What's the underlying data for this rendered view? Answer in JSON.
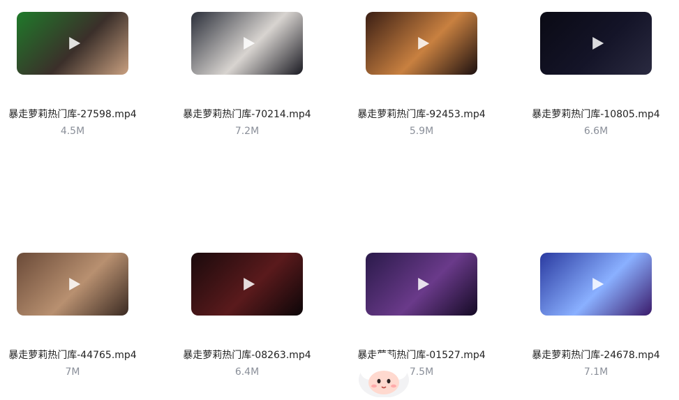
{
  "files": [
    {
      "name": "暴走萝莉热门库-27598.mp4",
      "size": "4.5M",
      "thumb_colors": [
        "#1f7a2a",
        "#3b2f2a",
        "#c9a080"
      ]
    },
    {
      "name": "暴走萝莉热门库-70214.mp4",
      "size": "7.2M",
      "thumb_colors": [
        "#2b2f3a",
        "#d8d4d0",
        "#1a1a22"
      ]
    },
    {
      "name": "暴走萝莉热门库-92453.mp4",
      "size": "5.9M",
      "thumb_colors": [
        "#3a1e14",
        "#c88040",
        "#1c1010"
      ]
    },
    {
      "name": "暴走萝莉热门库-10805.mp4",
      "size": "6.6M",
      "thumb_colors": [
        "#0a0a14",
        "#141428",
        "#2a2a40"
      ]
    },
    {
      "name": "暴走萝莉热门库-44765.mp4",
      "size": "7M",
      "thumb_colors": [
        "#6a4a38",
        "#b89070",
        "#3a2a22"
      ]
    },
    {
      "name": "暴走萝莉热门库-08263.mp4",
      "size": "6.4M",
      "thumb_colors": [
        "#1a0a0c",
        "#5a1a1c",
        "#0c0608"
      ]
    },
    {
      "name": "暴走萝莉热门库-01527.mp4",
      "size": "7.5M",
      "thumb_colors": [
        "#2a1a4a",
        "#6a3a8a",
        "#140a24"
      ]
    },
    {
      "name": "暴走萝莉热门库-24678.mp4",
      "size": "7.1M",
      "thumb_colors": [
        "#2a3aa0",
        "#8ab0ff",
        "#3a1a6a"
      ]
    }
  ],
  "icons": {
    "play": "play-icon",
    "mascot": "mascot-icon"
  }
}
